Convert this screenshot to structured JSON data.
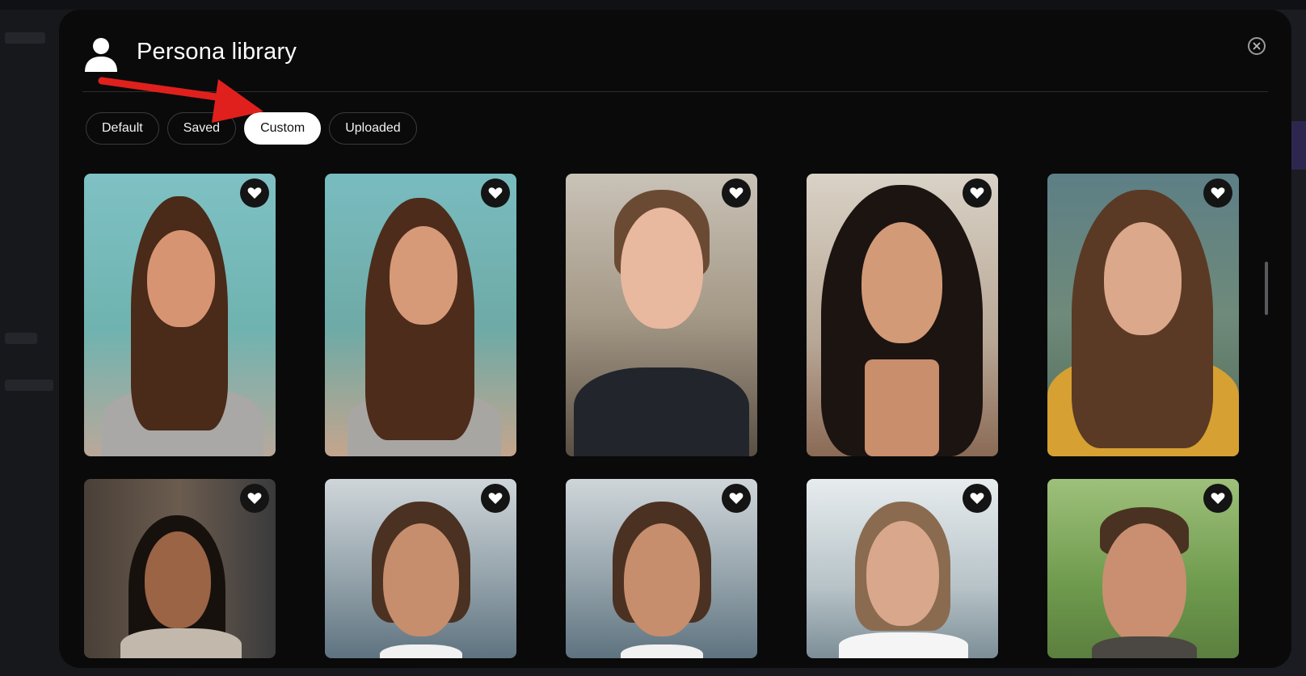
{
  "modal": {
    "title": "Persona library",
    "close_icon": "close-circle-icon",
    "person_icon": "person-silhouette-icon"
  },
  "tabs": [
    {
      "label": "Default",
      "active": false
    },
    {
      "label": "Saved",
      "active": false
    },
    {
      "label": "Custom",
      "active": true
    },
    {
      "label": "Uploaded",
      "active": false
    }
  ],
  "personas": [
    {
      "name": "persona-1",
      "favorite_icon": "heart-icon"
    },
    {
      "name": "persona-2",
      "favorite_icon": "heart-icon"
    },
    {
      "name": "persona-3",
      "favorite_icon": "heart-icon"
    },
    {
      "name": "persona-4",
      "favorite_icon": "heart-icon"
    },
    {
      "name": "persona-5",
      "favorite_icon": "heart-icon"
    },
    {
      "name": "persona-6",
      "favorite_icon": "heart-icon"
    },
    {
      "name": "persona-7",
      "favorite_icon": "heart-icon"
    },
    {
      "name": "persona-8",
      "favorite_icon": "heart-icon"
    },
    {
      "name": "persona-9",
      "favorite_icon": "heart-icon"
    },
    {
      "name": "persona-10",
      "favorite_icon": "heart-icon"
    }
  ],
  "colors": {
    "modal_bg": "#0a0a0b",
    "active_tab_bg": "#ffffff",
    "annotation_arrow": "#e0201c"
  }
}
